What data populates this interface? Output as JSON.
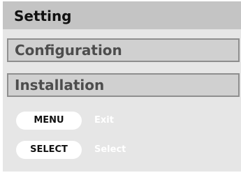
{
  "header": {
    "title": "Setting"
  },
  "menu": {
    "items": [
      {
        "label": "Configuration"
      },
      {
        "label": "Installation"
      }
    ]
  },
  "keys": [
    {
      "key": "MENU",
      "action": "Exit"
    },
    {
      "key": "SELECT",
      "action": "Select"
    }
  ],
  "colors": {
    "background": "#ffffff",
    "panel": "#e6e6e6",
    "header": "#c4c4c4",
    "menu_item": "#d0d0d0",
    "menu_border": "#8e8e8e",
    "key_pill": "#ffffff",
    "key_action_text": "#ffffff"
  }
}
